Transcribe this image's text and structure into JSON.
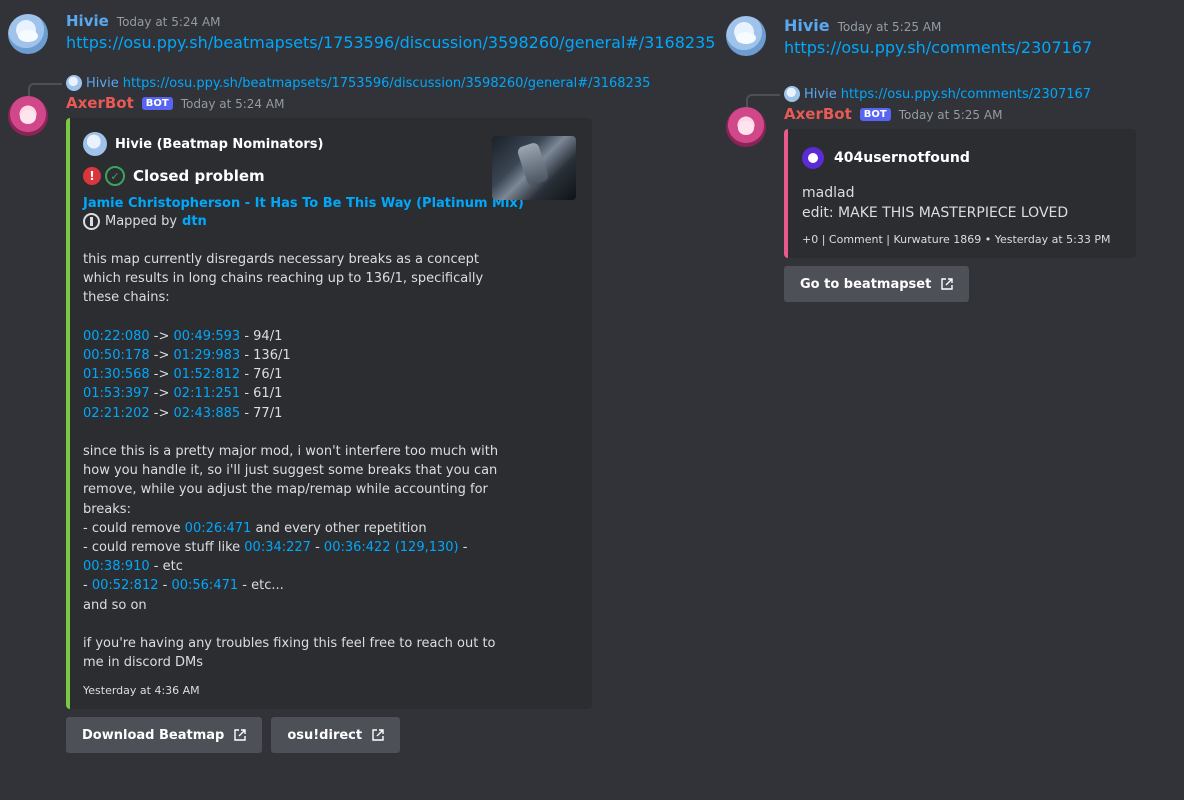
{
  "colors": {
    "bg": "#313338",
    "link": "#00a8fc",
    "hivie": "#5aa8f0",
    "axer": "#e85a55",
    "embed_green": "#7ac943",
    "embed_pink": "#e85a8a"
  },
  "left": {
    "hivie_msg": {
      "author": "Hivie",
      "timestamp": "Today at 5:24 AM",
      "link": "https://osu.ppy.sh/beatmapsets/1753596/discussion/3598260/general#/3168235"
    },
    "reply": {
      "author": "Hivie",
      "link": "https://osu.ppy.sh/beatmapsets/1753596/discussion/3598260/general#/3168235"
    },
    "bot_msg": {
      "author": "AxerBot",
      "bot_tag": "BOT",
      "timestamp": "Today at 5:24 AM",
      "embed": {
        "author": "Hivie (Beatmap Nominators)",
        "title": "Closed problem",
        "beatmap": "Jamie Christopherson - It Has To Be This Way (Platinum Mix)",
        "mapped_by": "Mapped by",
        "mapper": "dtn",
        "intro": "this map currently disregards necessary breaks as a concept which results in long chains reaching up to 136/1, specifically these chains:",
        "chains": [
          {
            "from": "00:22:080",
            "arrow": " -> ",
            "to": "00:49:593",
            "value": " - 94/1"
          },
          {
            "from": "00:50:178",
            "arrow": " -> ",
            "to": "01:29:983",
            "value": " - 136/1"
          },
          {
            "from": "01:30:568",
            "arrow": " -> ",
            "to": "01:52:812",
            "value": " - 76/1"
          },
          {
            "from": "01:53:397",
            "arrow": " -> ",
            "to": "02:11:251",
            "value": " - 61/1"
          },
          {
            "from": "02:21:202",
            "arrow": " -> ",
            "to": "02:43:885",
            "value": " - 77/1"
          }
        ],
        "para2": "since this is a pretty major mod, i won't interfere too much with how you handle it, so i'll just suggest some breaks that you can remove, while you adjust the map/remap while accounting for breaks:",
        "b1_pre": "- could remove ",
        "b1_time": "00:26:471",
        "b1_post": " and every other repetition",
        "b2_pre": "- could remove stuff like ",
        "b2_t1": "00:34:227",
        "b2_sep": " - ",
        "b2_t2": "00:36:422 (129,130)",
        "b2_sep2": " - ",
        "b2_t3": "00:38:910",
        "b2_post": " - etc",
        "b3_pre": "- ",
        "b3_t1": "00:52:812",
        "b3_sep": " - ",
        "b3_t2": "00:56:471",
        "b3_post": " - etc...",
        "and_so_on": "and so on",
        "para3": "if you're having any troubles fixing this feel free to reach out to me in discord DMs",
        "footer": "Yesterday at 4:36 AM"
      },
      "buttons": [
        "Download Beatmap",
        "osu!direct"
      ]
    }
  },
  "right": {
    "hivie_msg": {
      "author": "Hivie",
      "timestamp": "Today at 5:25 AM",
      "link": "https://osu.ppy.sh/comments/2307167"
    },
    "reply": {
      "author": "Hivie",
      "link": "https://osu.ppy.sh/comments/2307167"
    },
    "bot_msg": {
      "author": "AxerBot",
      "bot_tag": "BOT",
      "timestamp": "Today at 5:25 AM",
      "embed": {
        "author": "404usernotfound",
        "line1": "madlad",
        "line2": "edit: MAKE THIS MASTERPIECE LOVED",
        "footer": "+0 | Comment | Kurwature 1869 • Yesterday at 5:33 PM"
      },
      "button": "Go to beatmapset"
    }
  }
}
